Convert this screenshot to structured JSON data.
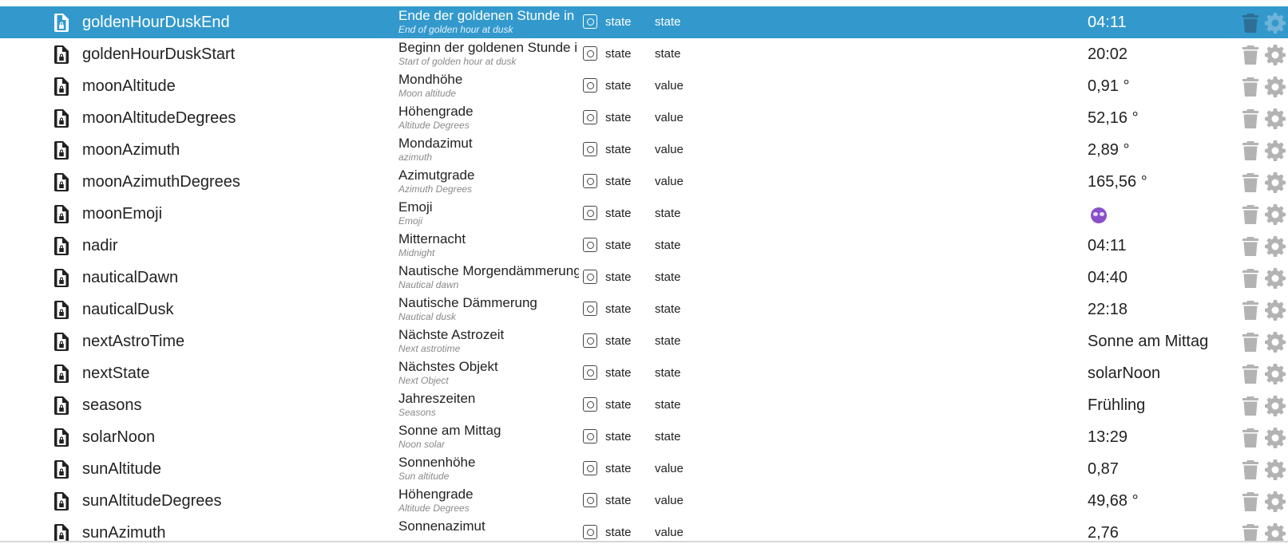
{
  "colors": {
    "selected_row": "#3399cc",
    "icon_grey": "#b3b3b3",
    "subtitle_grey": "#8a8a8a"
  },
  "rows": [
    {
      "id": "goldenHourDuskEnd",
      "name": "Ende der goldenen Stunde in",
      "desc": "End of golden hour at dusk",
      "type": "state",
      "role": "state",
      "value": "04:11",
      "selected": true
    },
    {
      "id": "goldenHourDuskStart",
      "name": "Beginn der goldenen Stunde i",
      "desc": "Start of golden hour at dusk",
      "type": "state",
      "role": "state",
      "value": "20:02"
    },
    {
      "id": "moonAltitude",
      "name": "Mondhöhe",
      "desc": "Moon altitude",
      "type": "state",
      "role": "value",
      "value": "0,91 °"
    },
    {
      "id": "moonAltitudeDegrees",
      "name": "Höhengrade",
      "desc": "Altitude Degrees",
      "type": "state",
      "role": "value",
      "value": "52,16 °"
    },
    {
      "id": "moonAzimuth",
      "name": "Mondazimut",
      "desc": "azimuth",
      "type": "state",
      "role": "value",
      "value": "2,89 °"
    },
    {
      "id": "moonAzimuthDegrees",
      "name": "Azimutgrade",
      "desc": "Azimuth Degrees",
      "type": "state",
      "role": "value",
      "value": "165,56 °"
    },
    {
      "id": "moonEmoji",
      "name": "Emoji",
      "desc": "Emoji",
      "type": "state",
      "role": "state",
      "value": "",
      "value_icon": "moon-face-emoji-icon"
    },
    {
      "id": "nadir",
      "name": "Mitternacht",
      "desc": "Midnight",
      "type": "state",
      "role": "state",
      "value": "04:11"
    },
    {
      "id": "nauticalDawn",
      "name": "Nautische Morgendämmerung",
      "desc": "Nautical dawn",
      "type": "state",
      "role": "state",
      "value": "04:40"
    },
    {
      "id": "nauticalDusk",
      "name": "Nautische Dämmerung",
      "desc": "Nautical dusk",
      "type": "state",
      "role": "state",
      "value": "22:18"
    },
    {
      "id": "nextAstroTime",
      "name": "Nächste Astrozeit",
      "desc": "Next astrotime",
      "type": "state",
      "role": "state",
      "value": "Sonne am Mittag"
    },
    {
      "id": "nextState",
      "name": "Nächstes Objekt",
      "desc": "Next Object",
      "type": "state",
      "role": "state",
      "value": "solarNoon"
    },
    {
      "id": "seasons",
      "name": "Jahreszeiten",
      "desc": "Seasons",
      "type": "state",
      "role": "state",
      "value": "Frühling"
    },
    {
      "id": "solarNoon",
      "name": "Sonne am Mittag",
      "desc": "Noon solar",
      "type": "state",
      "role": "state",
      "value": "13:29"
    },
    {
      "id": "sunAltitude",
      "name": "Sonnenhöhe",
      "desc": "Sun altitude",
      "type": "state",
      "role": "value",
      "value": "0,87"
    },
    {
      "id": "sunAltitudeDegrees",
      "name": "Höhengrade",
      "desc": "Altitude Degrees",
      "type": "state",
      "role": "value",
      "value": "49,68 °"
    },
    {
      "id": "sunAzimuth",
      "name": "Sonnenazimut",
      "desc": "",
      "type": "state",
      "role": "value",
      "value": "2,76"
    }
  ]
}
